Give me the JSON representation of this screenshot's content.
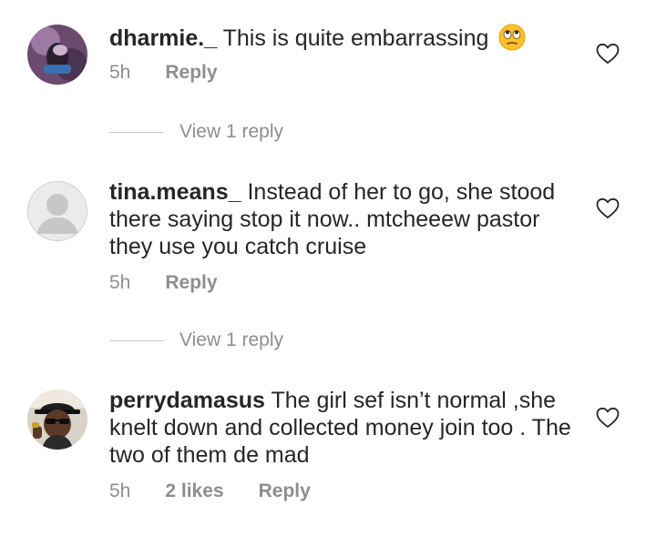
{
  "comments": [
    {
      "username": "dharmie._",
      "text": "This is quite embarrassing",
      "emoji": "face-with-rolling-eyes",
      "time": "5h",
      "reply_label": "Reply",
      "avatar": "photo-avatar"
    },
    {
      "username": "tina.means_",
      "text": "Instead of her to go, she stood there saying stop it now.. mtcheeew pastor they use you catch cruise",
      "time": "5h",
      "reply_label": "Reply",
      "avatar": "default-avatar"
    },
    {
      "username": "perrydamasus",
      "text": "The girl sef isn’t normal ,she knelt down and collected money join too . The two of them de mad",
      "time": "5h",
      "likes": "2 likes",
      "reply_label": "Reply",
      "avatar": "photo-avatar"
    }
  ],
  "view_replies": [
    {
      "label": "View 1 reply"
    },
    {
      "label": "View 1 reply"
    }
  ],
  "icons": {
    "like": "heart-outline-icon"
  },
  "colors": {
    "text": "#262626",
    "muted": "#8e8e8e",
    "divider": "#c7c7c7"
  }
}
